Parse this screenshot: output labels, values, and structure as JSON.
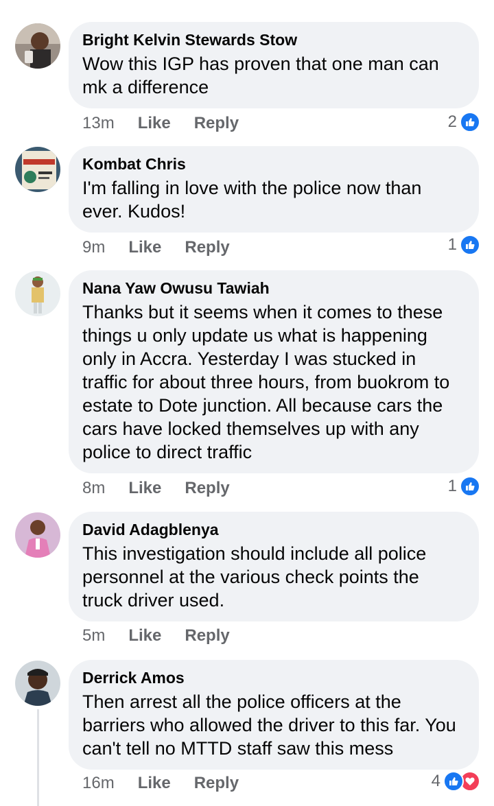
{
  "comments": [
    {
      "author": "Bright Kelvin Stewards Stow",
      "lines": [
        "Wow this IGP has proven that one man can",
        "mk a difference"
      ],
      "time": "13m",
      "like_label": "Like",
      "reply_label": "Reply",
      "reaction_count": "2",
      "reactions": [
        "like-icon"
      ]
    },
    {
      "author": "Kombat Chris",
      "lines": [
        "I'm falling in love with the police now than",
        "ever. Kudos!"
      ],
      "time": "9m",
      "like_label": "Like",
      "reply_label": "Reply",
      "reaction_count": "1",
      "reactions": [
        "like-icon"
      ]
    },
    {
      "author": "Nana Yaw Owusu Tawiah",
      "lines": [
        "Thanks but it seems when it comes to these",
        "things u only update us what is happening",
        "only in Accra. Yesterday I was stucked in",
        "traffic for about three hours, from buokrom to",
        "estate to Dote junction. All  because cars the",
        "cars have locked themselves up with any",
        "police to direct traffic"
      ],
      "time": "8m",
      "like_label": "Like",
      "reply_label": "Reply",
      "reaction_count": "1",
      "reactions": [
        "like-icon"
      ]
    },
    {
      "author": "David Adagblenya",
      "lines": [
        "This investigation should include all police",
        "personnel at the various check points the",
        "truck driver used."
      ],
      "time": "5m",
      "like_label": "Like",
      "reply_label": "Reply",
      "reaction_count": "",
      "reactions": []
    },
    {
      "author": "Derrick Amos",
      "lines": [
        "Then arrest all the police officers at the",
        "barriers who allowed the driver to this far. You",
        "can't tell no MTTD staff saw this mess"
      ],
      "time": "16m",
      "like_label": "Like",
      "reply_label": "Reply",
      "reaction_count": "4",
      "reactions": [
        "like-icon",
        "love-icon"
      ]
    }
  ],
  "colors": {
    "bubble": "#f0f2f5",
    "meta_text": "#65676b",
    "like_blue": "#1877f2",
    "love_red": "#f33e58"
  }
}
